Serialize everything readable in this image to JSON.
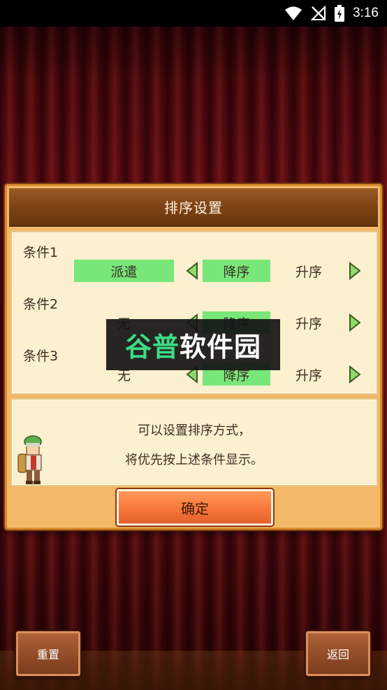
{
  "status_bar": {
    "time": "3:16",
    "icons": [
      "wifi-icon",
      "no-signal-icon",
      "battery-charging-icon"
    ]
  },
  "dialog": {
    "title": "排序设置",
    "conditions": [
      {
        "label": "条件1",
        "value": "派遣",
        "order_desc": "降序",
        "order_asc": "升序",
        "selected_order": "降序"
      },
      {
        "label": "条件2",
        "value": "无",
        "order_desc": "降序",
        "order_asc": "升序",
        "selected_order": "降序"
      },
      {
        "label": "条件3",
        "value": "无",
        "order_desc": "降序",
        "order_asc": "升序",
        "selected_order": "降序"
      }
    ],
    "message_lines": [
      "可以设置排序方式，",
      "将优先按上述条件显示。"
    ],
    "confirm_label": "确定"
  },
  "bottom": {
    "reset_label": "重置",
    "back_label": "返回"
  },
  "watermark": {
    "text_part1": "谷普",
    "text_part2": "软件园"
  },
  "colors": {
    "selected_cell": "#79e679",
    "confirm_button": "#f7763a",
    "header_bar": "#7d4316",
    "watermark_green": "#3ddc84"
  }
}
